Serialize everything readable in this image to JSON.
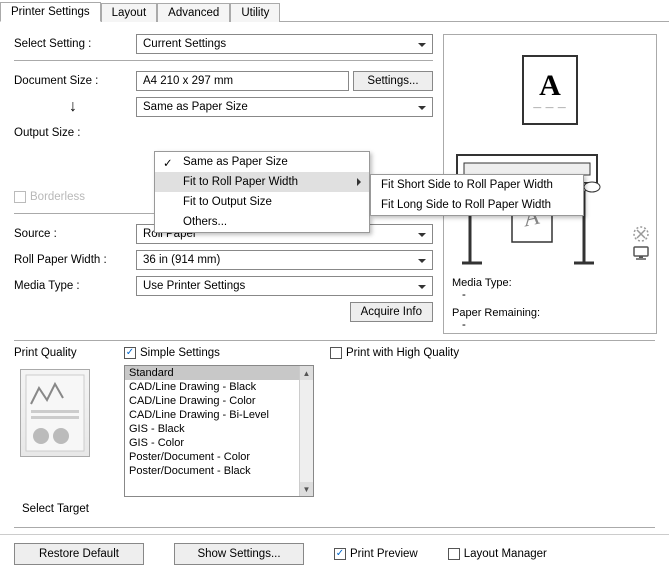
{
  "tabs": [
    "Printer Settings",
    "Layout",
    "Advanced",
    "Utility"
  ],
  "labels": {
    "select_setting": "Select Setting :",
    "document_size": "Document Size :",
    "output_size": "Output Size :",
    "borderless": "Borderless",
    "source": "Source :",
    "roll_width": "Roll Paper Width :",
    "media_type_lbl": "Media Type :",
    "print_quality": "Print Quality",
    "select_target": "Select Target",
    "simple_settings": "Simple Settings",
    "print_high_quality": "Print with High Quality",
    "media_type_info": "Media Type:",
    "paper_remaining": "Paper Remaining:",
    "restore_default": "Restore Default",
    "show_settings": "Show Settings...",
    "print_preview": "Print Preview",
    "layout_manager": "Layout Manager",
    "settings_btn": "Settings...",
    "acquire_info": "Acquire Info",
    "dash": "-"
  },
  "values": {
    "select_setting": "Current Settings",
    "document_size": "A4 210 x 297 mm",
    "same_as_paper": "Same as Paper Size",
    "source": "Roll Paper",
    "roll_width": "36 in (914 mm)",
    "media_type": "Use Printer Settings"
  },
  "menu1": {
    "items": [
      "Same as Paper Size",
      "Fit to Roll Paper Width",
      "Fit to Output Size",
      "Others..."
    ],
    "checked_index": 0,
    "highlight_index": 1,
    "submenu_index": 1
  },
  "menu2": {
    "items": [
      "Fit Short Side to Roll Paper Width",
      "Fit Long Side to Roll Paper Width"
    ]
  },
  "targets": [
    "Standard",
    "CAD/Line Drawing - Black",
    "CAD/Line Drawing - Color",
    "CAD/Line Drawing - Bi-Level",
    "GIS - Black",
    "GIS - Color",
    "Poster/Document - Color",
    "Poster/Document - Black"
  ],
  "targets_selected_index": 0,
  "checkboxes": {
    "simple_settings": true,
    "print_high_quality": false,
    "print_preview": true,
    "layout_manager": false
  },
  "glyphs": {
    "A": "A"
  }
}
